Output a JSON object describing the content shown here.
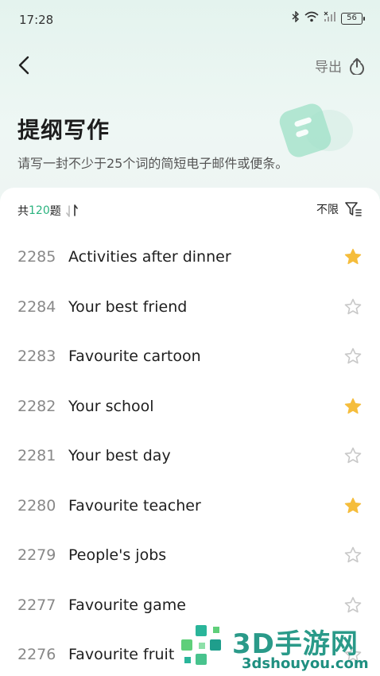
{
  "status_bar": {
    "time": "17:28",
    "battery": "56"
  },
  "header": {
    "export_label": "导出",
    "title": "提纲写作",
    "subtitle": "请写一封不少于25个词的简短电子邮件或便条。"
  },
  "list_header": {
    "count_prefix": "共",
    "count": "120",
    "count_suffix": "题",
    "filter_label": "不限"
  },
  "items": [
    {
      "num": "2285",
      "title": "Activities after dinner",
      "starred": true
    },
    {
      "num": "2284",
      "title": "Your best friend",
      "starred": false
    },
    {
      "num": "2283",
      "title": "Favourite cartoon",
      "starred": false
    },
    {
      "num": "2282",
      "title": "Your school",
      "starred": true
    },
    {
      "num": "2281",
      "title": "Your best day",
      "starred": false
    },
    {
      "num": "2280",
      "title": "Favourite teacher",
      "starred": true
    },
    {
      "num": "2279",
      "title": "People's jobs",
      "starred": false
    },
    {
      "num": "2277",
      "title": "Favourite game",
      "starred": false
    },
    {
      "num": "2276",
      "title": "Favourite fruit",
      "starred": false
    }
  ],
  "colors": {
    "accent": "#2bb37f",
    "star_filled": "#f5bd3c",
    "star_outline": "#c8c8c8"
  },
  "watermark": {
    "brand": "3D手游网",
    "url": "3dshouyou.com"
  }
}
